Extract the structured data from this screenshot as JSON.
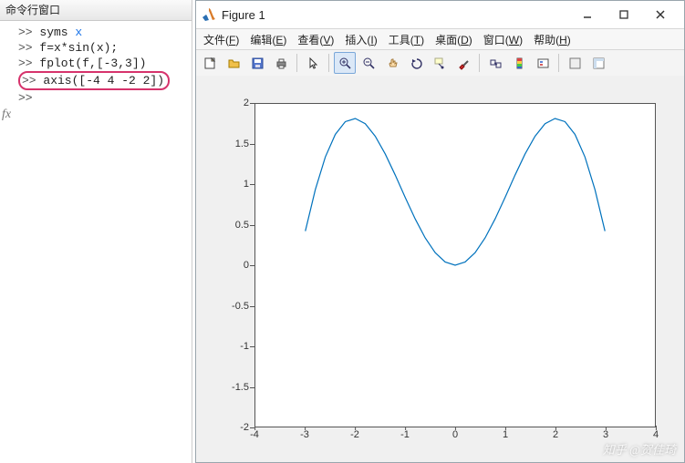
{
  "command_window": {
    "title": "命令行窗口",
    "fx": "fx",
    "lines": [
      {
        "prompt": ">> ",
        "pre": "syms ",
        "sym": "x",
        "post": ""
      },
      {
        "prompt": ">> ",
        "pre": "f=x*sin(x);",
        "sym": "",
        "post": ""
      },
      {
        "prompt": ">> ",
        "pre": "fplot(f,[-3,3])",
        "sym": "",
        "post": ""
      },
      {
        "prompt": ">> ",
        "pre": "axis([-4 4 -2 2])",
        "sym": "",
        "post": "",
        "highlight": true
      },
      {
        "prompt": ">> ",
        "pre": "",
        "sym": "",
        "post": ""
      }
    ]
  },
  "figure_window": {
    "title": "Figure 1",
    "menus": [
      {
        "label": "文件",
        "key": "F"
      },
      {
        "label": "编辑",
        "key": "E"
      },
      {
        "label": "查看",
        "key": "V"
      },
      {
        "label": "插入",
        "key": "I"
      },
      {
        "label": "工具",
        "key": "T"
      },
      {
        "label": "桌面",
        "key": "D"
      },
      {
        "label": "窗口",
        "key": "W"
      },
      {
        "label": "帮助",
        "key": "H"
      }
    ],
    "toolbar_icons": [
      "new-figure-icon",
      "open-icon",
      "save-icon",
      "print-icon",
      "sep",
      "pointer-icon",
      "sep",
      "zoom-in-icon",
      "zoom-out-icon",
      "pan-icon",
      "rotate-icon",
      "datatip-icon",
      "brush-icon",
      "sep",
      "link-icon",
      "colorbar-icon",
      "legend-icon",
      "sep",
      "hide-tools-icon",
      "show-tools-icon"
    ],
    "active_tool_index": 7
  },
  "chart_data": {
    "type": "line",
    "title": "",
    "xlabel": "",
    "ylabel": "",
    "xlim": [
      -4,
      4
    ],
    "ylim": [
      -2,
      2
    ],
    "xticks": [
      -4,
      -3,
      -2,
      -1,
      0,
      1,
      2,
      3,
      4
    ],
    "yticks": [
      -2,
      -1.5,
      -1,
      -0.5,
      0,
      0.5,
      1,
      1.5,
      2
    ],
    "series": [
      {
        "name": "x*sin(x)",
        "color": "#0072BD",
        "x": [
          -3,
          -2.8,
          -2.6,
          -2.4,
          -2.2,
          -2,
          -1.8,
          -1.6,
          -1.4,
          -1.2,
          -1,
          -0.8,
          -0.6,
          -0.4,
          -0.2,
          0,
          0.2,
          0.4,
          0.6,
          0.8,
          1,
          1.2,
          1.4,
          1.6,
          1.8,
          2,
          2.2,
          2.4,
          2.6,
          2.8,
          3
        ],
        "y": [
          0.423,
          0.937,
          1.341,
          1.622,
          1.78,
          1.819,
          1.754,
          1.599,
          1.379,
          1.118,
          0.841,
          0.574,
          0.339,
          0.156,
          0.04,
          0,
          0.04,
          0.156,
          0.339,
          0.574,
          0.841,
          1.118,
          1.379,
          1.599,
          1.754,
          1.819,
          1.78,
          1.622,
          1.341,
          0.937,
          0.423
        ]
      }
    ]
  },
  "colors": {
    "curve": "#0072BD"
  },
  "watermark": "知乎 @贺佳琦"
}
